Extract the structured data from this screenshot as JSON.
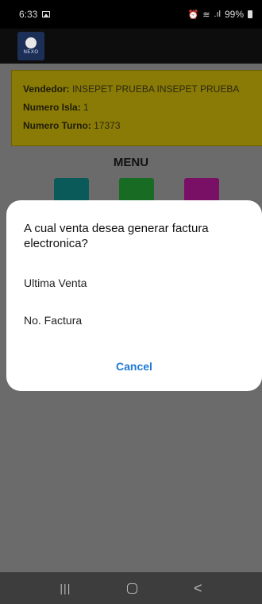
{
  "status_bar": {
    "time": "6:33",
    "battery": "99%",
    "icons": [
      "image-icon",
      "alarm-icon",
      "wifi-icon",
      "signal-icon",
      "battery-icon"
    ]
  },
  "app_bar": {
    "logo_text": "NEXO"
  },
  "info": {
    "vendedor_label": "Vendedor:",
    "vendedor_value": "INSEPET PRUEBA  INSEPET PRUEBA",
    "isla_label": "Numero Isla:",
    "isla_value": "1",
    "turno_label": "Numero Turno:",
    "turno_value": "17373"
  },
  "menu": {
    "title": "MENU",
    "icons": [
      "cart-icon",
      "invoice-icon",
      "store-icon"
    ]
  },
  "dialog": {
    "title": "A cual venta desea generar factura electronica?",
    "options": [
      "Ultima Venta",
      "No. Factura"
    ],
    "cancel_label": "Cancel"
  },
  "nav_bar": {
    "recent": "|||",
    "back": "<"
  },
  "colors": {
    "info_panel": "#8a7a06",
    "dialog_accent": "#1e7ad4"
  }
}
